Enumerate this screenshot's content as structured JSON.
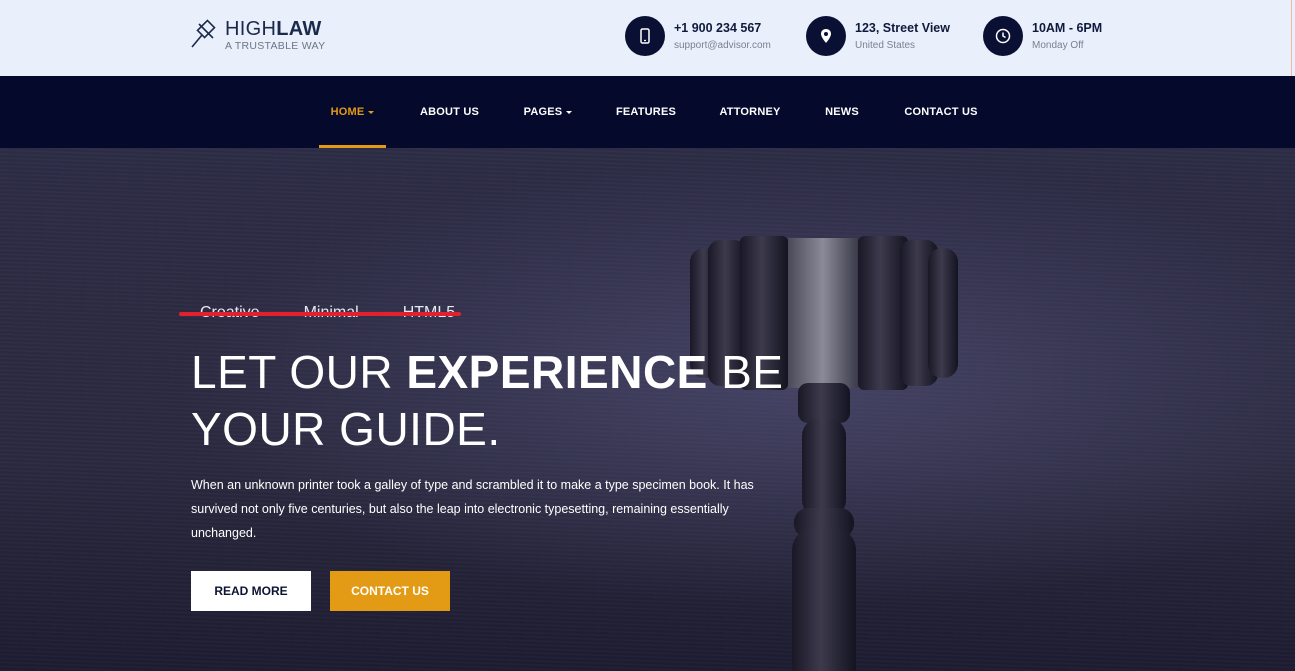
{
  "brand": {
    "name_light": "HIGH",
    "name_bold": "LAW",
    "tagline": "A TRUSTABLE WAY",
    "icon": "gavel-logo-icon"
  },
  "contacts": [
    {
      "icon": "phone-icon",
      "title": "+1 900 234 567",
      "subtitle": "support@advisor.com"
    },
    {
      "icon": "location-pin-icon",
      "title": "123, Street View",
      "subtitle": "United States"
    },
    {
      "icon": "clock-icon",
      "title": "10AM - 6PM",
      "subtitle": "Monday Off"
    }
  ],
  "nav": {
    "items": [
      {
        "label": "HOME",
        "dropdown": true,
        "active": true
      },
      {
        "label": "ABOUT US",
        "dropdown": false,
        "active": false
      },
      {
        "label": "PAGES",
        "dropdown": true,
        "active": false
      },
      {
        "label": "FEATURES",
        "dropdown": false,
        "active": false
      },
      {
        "label": "ATTORNEY",
        "dropdown": false,
        "active": false
      },
      {
        "label": "NEWS",
        "dropdown": false,
        "active": false
      },
      {
        "label": "CONTACT US",
        "dropdown": false,
        "active": false
      }
    ]
  },
  "hero": {
    "typer_words": [
      "Creative",
      "Minimal",
      "HTML5"
    ],
    "headline_1a": "LET OUR ",
    "headline_1b": "EXPERIENCE",
    "headline_1c": " BE",
    "headline_2": "YOUR GUIDE.",
    "paragraph": "When an unknown printer took a galley of type and scrambled it to make a type specimen book. It has survived not only five centuries, but also the leap into electronic typesetting, remaining essentially unchanged.",
    "read_more_label": "READ MORE",
    "contact_label": "CONTACT US"
  },
  "colors": {
    "accent": "#e39a14",
    "nav_bg": "#050a2d",
    "topbar_bg": "#e9f0fb",
    "icon_circle": "#0a1033",
    "strike_red": "#e3202d"
  }
}
